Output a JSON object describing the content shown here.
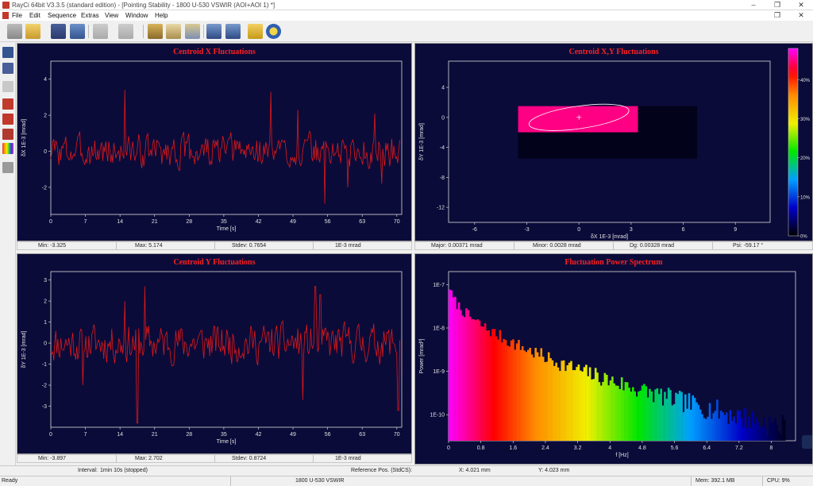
{
  "window": {
    "title": "RayCi 64bit V3.3.5 (standard edition) - [Pointing Stability - 1800 U-530 VSWIR (AOI+AOI 1) *]"
  },
  "menu": [
    "File",
    "Edit",
    "Sequence",
    "Extras",
    "View",
    "Window",
    "Help"
  ],
  "panels": {
    "cx": {
      "title": "Centroid X Fluctuations",
      "xlabel": "Time [s]",
      "ylabel": "δX 1E-3 [mrad]",
      "xticks": [
        "0",
        "7",
        "14",
        "21",
        "28",
        "35",
        "42",
        "49",
        "56",
        "63",
        "70"
      ],
      "yticks": [
        "4",
        "2",
        "0",
        "-2"
      ],
      "stats": [
        "Min: -3.325",
        "Max: 5.174",
        "Stdev: 0.7654",
        "1E-3 mrad"
      ]
    },
    "cxy": {
      "title": "Centroid X,Y Fluctuations",
      "xlabel": "δX 1E-3 [mrad]",
      "ylabel": "δY 1E-3 [mrad]",
      "xticks": [
        "-6",
        "-3",
        "0",
        "3",
        "6",
        "9"
      ],
      "yticks": [
        "4",
        "0",
        "-4",
        "-8",
        "-12"
      ],
      "colorbar": [
        "40%",
        "30%",
        "20%",
        "10%",
        "0%"
      ],
      "stats": [
        "Major: 0.00371 mrad",
        "Minor: 0.0028 mrad",
        "Dg: 0.00328 mrad",
        "Psi: -59.17 °"
      ]
    },
    "cy": {
      "title": "Centroid Y Fluctuations",
      "xlabel": "Time [s]",
      "ylabel": "δY 1E-3 [mrad]",
      "xticks": [
        "0",
        "7",
        "14",
        "21",
        "28",
        "35",
        "42",
        "49",
        "56",
        "63",
        "70"
      ],
      "yticks": [
        "3",
        "2",
        "1",
        "0",
        "-1",
        "-2",
        "-3"
      ],
      "stats": [
        "Min: -3.897",
        "Max: 2.702",
        "Stdev: 0.8724",
        "1E-3 mrad"
      ]
    },
    "fps": {
      "title": "Fluctuation Power Spectrum",
      "xlabel": "f [Hz]",
      "ylabel": "Power [mrad²]",
      "xticks": [
        "0",
        "0.8",
        "1.6",
        "2.4",
        "3.2",
        "4",
        "4.8",
        "5.6",
        "6.4",
        "7.2",
        "8"
      ],
      "yticks": [
        "1E-7",
        "1E-8",
        "1E-9",
        "1E-10"
      ]
    }
  },
  "bottom_info": {
    "interval_label": "Interval:",
    "interval_value": "1min 10s (stopped)",
    "ref_pos": "Reference Pos. (StdCS):",
    "x_pos": "X: 4.021 mm",
    "y_pos": "Y: 4.023 mm"
  },
  "status": {
    "ready": "Ready",
    "device": "1800 U-530 VSWIR",
    "mem": "Mem: 392.1 MB",
    "cpu": "CPU: 9%"
  },
  "chart_data": [
    {
      "type": "line",
      "title": "Centroid X Fluctuations",
      "xlabel": "Time [s]",
      "ylabel": "δX 1E-3 [mrad]",
      "xlim": [
        0,
        71
      ],
      "ylim": [
        -3.5,
        5
      ],
      "n_points": 350,
      "seed": 3,
      "spikes": [
        [
          15.0,
          3.4
        ],
        [
          44.5,
          3.3
        ],
        [
          50.0,
          2.3
        ],
        [
          55.5,
          -2.9
        ],
        [
          60.0,
          -2.0
        ],
        [
          65.5,
          2.1
        ],
        [
          67.0,
          -1.8
        ]
      ],
      "min": -3.325,
      "max": 5.174,
      "stdev": 0.7654
    },
    {
      "type": "heatmap",
      "title": "Centroid X,Y Fluctuations",
      "xlabel": "δX 1E-3 [mrad]",
      "ylabel": "δY 1E-3 [mrad]",
      "xlim": [
        -7.5,
        11
      ],
      "ylim": [
        -14,
        7.5
      ],
      "cells": [
        {
          "x0": -3.5,
          "x1": 0,
          "y0": -2,
          "y1": 1.5,
          "value": 0.45
        },
        {
          "x0": 0,
          "x1": 3.4,
          "y0": -2,
          "y1": 1.5,
          "value": 0.45
        },
        {
          "x0": 3.4,
          "x1": 6.8,
          "y0": -2,
          "y1": 1.5,
          "value": 0.0
        },
        {
          "x0": -3.5,
          "x1": 0,
          "y0": -5.5,
          "y1": -2,
          "value": 0.0
        },
        {
          "x0": 0,
          "x1": 3.4,
          "y0": -5.5,
          "y1": -2,
          "value": 0.0
        },
        {
          "x0": 3.4,
          "x1": 6.8,
          "y0": -5.5,
          "y1": -2,
          "value": 0.0
        }
      ],
      "ellipse": {
        "cx": 0,
        "cy": 0,
        "rx": 2.9,
        "ry": 1.5,
        "rotation_deg": -8
      },
      "colorbar_range": [
        0,
        0.48
      ]
    },
    {
      "type": "line",
      "title": "Centroid Y Fluctuations",
      "xlabel": "Time [s]",
      "ylabel": "δY 1E-3 [mrad]",
      "xlim": [
        0,
        71
      ],
      "ylim": [
        -4,
        3.4
      ],
      "n_points": 350,
      "seed": 11,
      "spikes": [
        [
          17.5,
          -3.8
        ],
        [
          15.0,
          2.0
        ],
        [
          19.0,
          2.7
        ],
        [
          53.5,
          2.7
        ],
        [
          54.5,
          2.3
        ],
        [
          51.0,
          -2.7
        ],
        [
          70.3,
          -3.2
        ],
        [
          6.5,
          -2.0
        ]
      ],
      "min": -3.897,
      "max": 2.702,
      "stdev": 0.8724
    },
    {
      "type": "bar",
      "title": "Fluctuation Power Spectrum",
      "xlabel": "f [Hz]",
      "ylabel": "Power [mrad²]",
      "xlim": [
        0,
        8.6
      ],
      "ylim_log10": [
        -10.6,
        -6.7
      ],
      "n_bins": 180,
      "seed": 7,
      "decay": {
        "start_log10": -7.05,
        "end_log10": -10.3,
        "shape": 0.55
      }
    }
  ]
}
